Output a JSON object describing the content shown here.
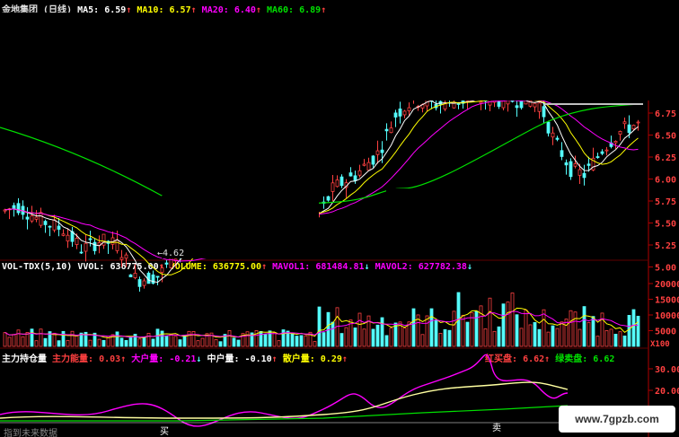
{
  "price_panel": {
    "title": "金地集团 (日线)",
    "ma5": {
      "label": "MA5:",
      "value": "6.59",
      "arrow": "↑"
    },
    "ma10": {
      "label": "MA10:",
      "value": "6.57",
      "arrow": "↑"
    },
    "ma20": {
      "label": "MA20:",
      "value": "6.40",
      "arrow": "↑"
    },
    "ma60": {
      "label": "MA60:",
      "value": "6.89",
      "arrow": "↑"
    },
    "low_annotation": "←4.62",
    "axis_ticks": [
      "6.75",
      "6.50",
      "6.25",
      "6.00",
      "5.75",
      "5.50",
      "5.25",
      "5.00"
    ]
  },
  "volume_panel": {
    "indicator": "VOL-TDX(5,10)",
    "vvol": {
      "label": "VVOL:",
      "value": "636775.00",
      "arrow": "↑"
    },
    "volume": {
      "label": "VOLUME:",
      "value": "636775.00",
      "arrow": "↑"
    },
    "mavol1": {
      "label": "MAVOL1:",
      "value": "681484.81",
      "arrow": "↓"
    },
    "mavol2": {
      "label": "MAVOL2:",
      "value": "627782.38",
      "arrow": "↓"
    },
    "axis_ticks": [
      "20000",
      "15000",
      "10000",
      "5000"
    ],
    "unit": "X100"
  },
  "indicator_panel": {
    "title": "主力持仓量",
    "main_force": {
      "label": "主力能量:",
      "value": "0.03",
      "arrow": "↑"
    },
    "big_holder": {
      "label": "大户量:",
      "value": "-0.21",
      "arrow": "↓"
    },
    "mid_holder": {
      "label": "中户量:",
      "value": "-0.10",
      "arrow": "↑"
    },
    "retail": {
      "label": "散户量:",
      "value": "0.29",
      "arrow": "↑"
    },
    "red_buy": {
      "label": "红买盘:",
      "value": "6.62",
      "arrow": "↑"
    },
    "green_sell": {
      "label": "绿卖盘:",
      "value": "6.62",
      "arrow": ""
    },
    "axis_ticks": [
      "30.00",
      "20.00"
    ],
    "buy_marker": "买",
    "sell_marker": "卖",
    "bottom_text": "指到未来数据"
  },
  "watermark": "www.7gpzb.com",
  "colors": {
    "up": "#ff4040",
    "down": "#54fcfc",
    "ma5": "#ffffff",
    "ma10": "#ffff00",
    "ma20": "#ff00ff",
    "ma60": "#00e000",
    "axis": "#b00000"
  }
}
